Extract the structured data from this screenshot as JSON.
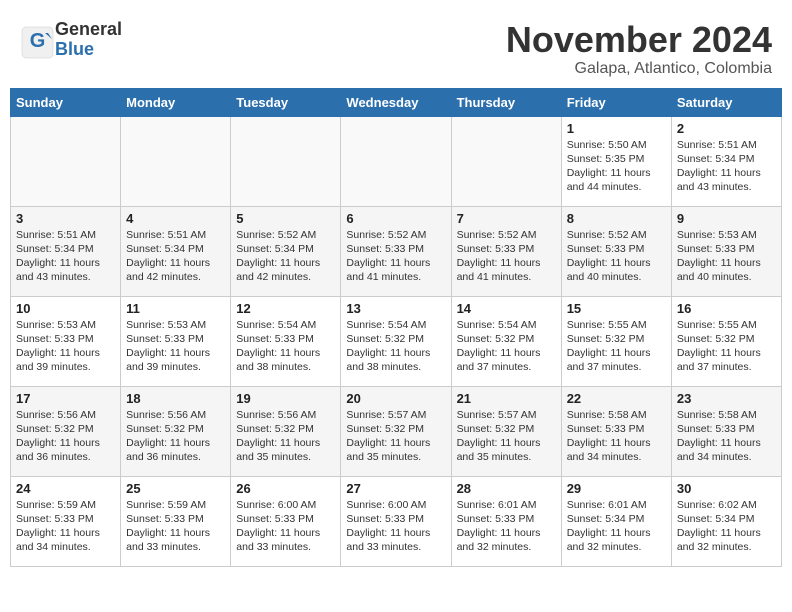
{
  "header": {
    "logo_general": "General",
    "logo_blue": "Blue",
    "month": "November 2024",
    "location": "Galapa, Atlantico, Colombia"
  },
  "weekdays": [
    "Sunday",
    "Monday",
    "Tuesday",
    "Wednesday",
    "Thursday",
    "Friday",
    "Saturday"
  ],
  "weeks": [
    [
      {
        "day": "",
        "info": ""
      },
      {
        "day": "",
        "info": ""
      },
      {
        "day": "",
        "info": ""
      },
      {
        "day": "",
        "info": ""
      },
      {
        "day": "",
        "info": ""
      },
      {
        "day": "1",
        "info": "Sunrise: 5:50 AM\nSunset: 5:35 PM\nDaylight: 11 hours\nand 44 minutes."
      },
      {
        "day": "2",
        "info": "Sunrise: 5:51 AM\nSunset: 5:34 PM\nDaylight: 11 hours\nand 43 minutes."
      }
    ],
    [
      {
        "day": "3",
        "info": "Sunrise: 5:51 AM\nSunset: 5:34 PM\nDaylight: 11 hours\nand 43 minutes."
      },
      {
        "day": "4",
        "info": "Sunrise: 5:51 AM\nSunset: 5:34 PM\nDaylight: 11 hours\nand 42 minutes."
      },
      {
        "day": "5",
        "info": "Sunrise: 5:52 AM\nSunset: 5:34 PM\nDaylight: 11 hours\nand 42 minutes."
      },
      {
        "day": "6",
        "info": "Sunrise: 5:52 AM\nSunset: 5:33 PM\nDaylight: 11 hours\nand 41 minutes."
      },
      {
        "day": "7",
        "info": "Sunrise: 5:52 AM\nSunset: 5:33 PM\nDaylight: 11 hours\nand 41 minutes."
      },
      {
        "day": "8",
        "info": "Sunrise: 5:52 AM\nSunset: 5:33 PM\nDaylight: 11 hours\nand 40 minutes."
      },
      {
        "day": "9",
        "info": "Sunrise: 5:53 AM\nSunset: 5:33 PM\nDaylight: 11 hours\nand 40 minutes."
      }
    ],
    [
      {
        "day": "10",
        "info": "Sunrise: 5:53 AM\nSunset: 5:33 PM\nDaylight: 11 hours\nand 39 minutes."
      },
      {
        "day": "11",
        "info": "Sunrise: 5:53 AM\nSunset: 5:33 PM\nDaylight: 11 hours\nand 39 minutes."
      },
      {
        "day": "12",
        "info": "Sunrise: 5:54 AM\nSunset: 5:33 PM\nDaylight: 11 hours\nand 38 minutes."
      },
      {
        "day": "13",
        "info": "Sunrise: 5:54 AM\nSunset: 5:32 PM\nDaylight: 11 hours\nand 38 minutes."
      },
      {
        "day": "14",
        "info": "Sunrise: 5:54 AM\nSunset: 5:32 PM\nDaylight: 11 hours\nand 37 minutes."
      },
      {
        "day": "15",
        "info": "Sunrise: 5:55 AM\nSunset: 5:32 PM\nDaylight: 11 hours\nand 37 minutes."
      },
      {
        "day": "16",
        "info": "Sunrise: 5:55 AM\nSunset: 5:32 PM\nDaylight: 11 hours\nand 37 minutes."
      }
    ],
    [
      {
        "day": "17",
        "info": "Sunrise: 5:56 AM\nSunset: 5:32 PM\nDaylight: 11 hours\nand 36 minutes."
      },
      {
        "day": "18",
        "info": "Sunrise: 5:56 AM\nSunset: 5:32 PM\nDaylight: 11 hours\nand 36 minutes."
      },
      {
        "day": "19",
        "info": "Sunrise: 5:56 AM\nSunset: 5:32 PM\nDaylight: 11 hours\nand 35 minutes."
      },
      {
        "day": "20",
        "info": "Sunrise: 5:57 AM\nSunset: 5:32 PM\nDaylight: 11 hours\nand 35 minutes."
      },
      {
        "day": "21",
        "info": "Sunrise: 5:57 AM\nSunset: 5:32 PM\nDaylight: 11 hours\nand 35 minutes."
      },
      {
        "day": "22",
        "info": "Sunrise: 5:58 AM\nSunset: 5:33 PM\nDaylight: 11 hours\nand 34 minutes."
      },
      {
        "day": "23",
        "info": "Sunrise: 5:58 AM\nSunset: 5:33 PM\nDaylight: 11 hours\nand 34 minutes."
      }
    ],
    [
      {
        "day": "24",
        "info": "Sunrise: 5:59 AM\nSunset: 5:33 PM\nDaylight: 11 hours\nand 34 minutes."
      },
      {
        "day": "25",
        "info": "Sunrise: 5:59 AM\nSunset: 5:33 PM\nDaylight: 11 hours\nand 33 minutes."
      },
      {
        "day": "26",
        "info": "Sunrise: 6:00 AM\nSunset: 5:33 PM\nDaylight: 11 hours\nand 33 minutes."
      },
      {
        "day": "27",
        "info": "Sunrise: 6:00 AM\nSunset: 5:33 PM\nDaylight: 11 hours\nand 33 minutes."
      },
      {
        "day": "28",
        "info": "Sunrise: 6:01 AM\nSunset: 5:33 PM\nDaylight: 11 hours\nand 32 minutes."
      },
      {
        "day": "29",
        "info": "Sunrise: 6:01 AM\nSunset: 5:34 PM\nDaylight: 11 hours\nand 32 minutes."
      },
      {
        "day": "30",
        "info": "Sunrise: 6:02 AM\nSunset: 5:34 PM\nDaylight: 11 hours\nand 32 minutes."
      }
    ]
  ]
}
